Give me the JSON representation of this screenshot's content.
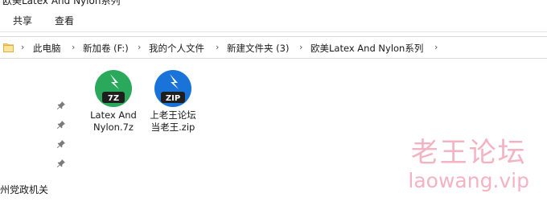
{
  "window": {
    "title": "欧美Latex And Nylon系列"
  },
  "ribbon": {
    "tabs": [
      "共享",
      "查看"
    ]
  },
  "address": {
    "icon": "folder-icon",
    "crumbs": [
      "此电脑",
      "新加卷 (F:)",
      "我的个人文件",
      "新建文件夹 (3)",
      "欧美Latex And Nylon系列"
    ]
  },
  "navpane": {
    "label": "州党政机关",
    "pin_icon": "pin-icon"
  },
  "files": [
    {
      "name_line1": "Latex And",
      "name_line2": "Nylon.7z",
      "badge": "7Z",
      "icon": "bandizip-7z-icon",
      "color": "#2aa95c"
    },
    {
      "name_line1": "上老王论坛",
      "name_line2": "当老王.zip",
      "badge": "ZIP",
      "icon": "bandizip-zip-icon",
      "color": "#1a73d9"
    }
  ],
  "watermark": {
    "text": "老王论坛",
    "url": "laowang.vip"
  }
}
